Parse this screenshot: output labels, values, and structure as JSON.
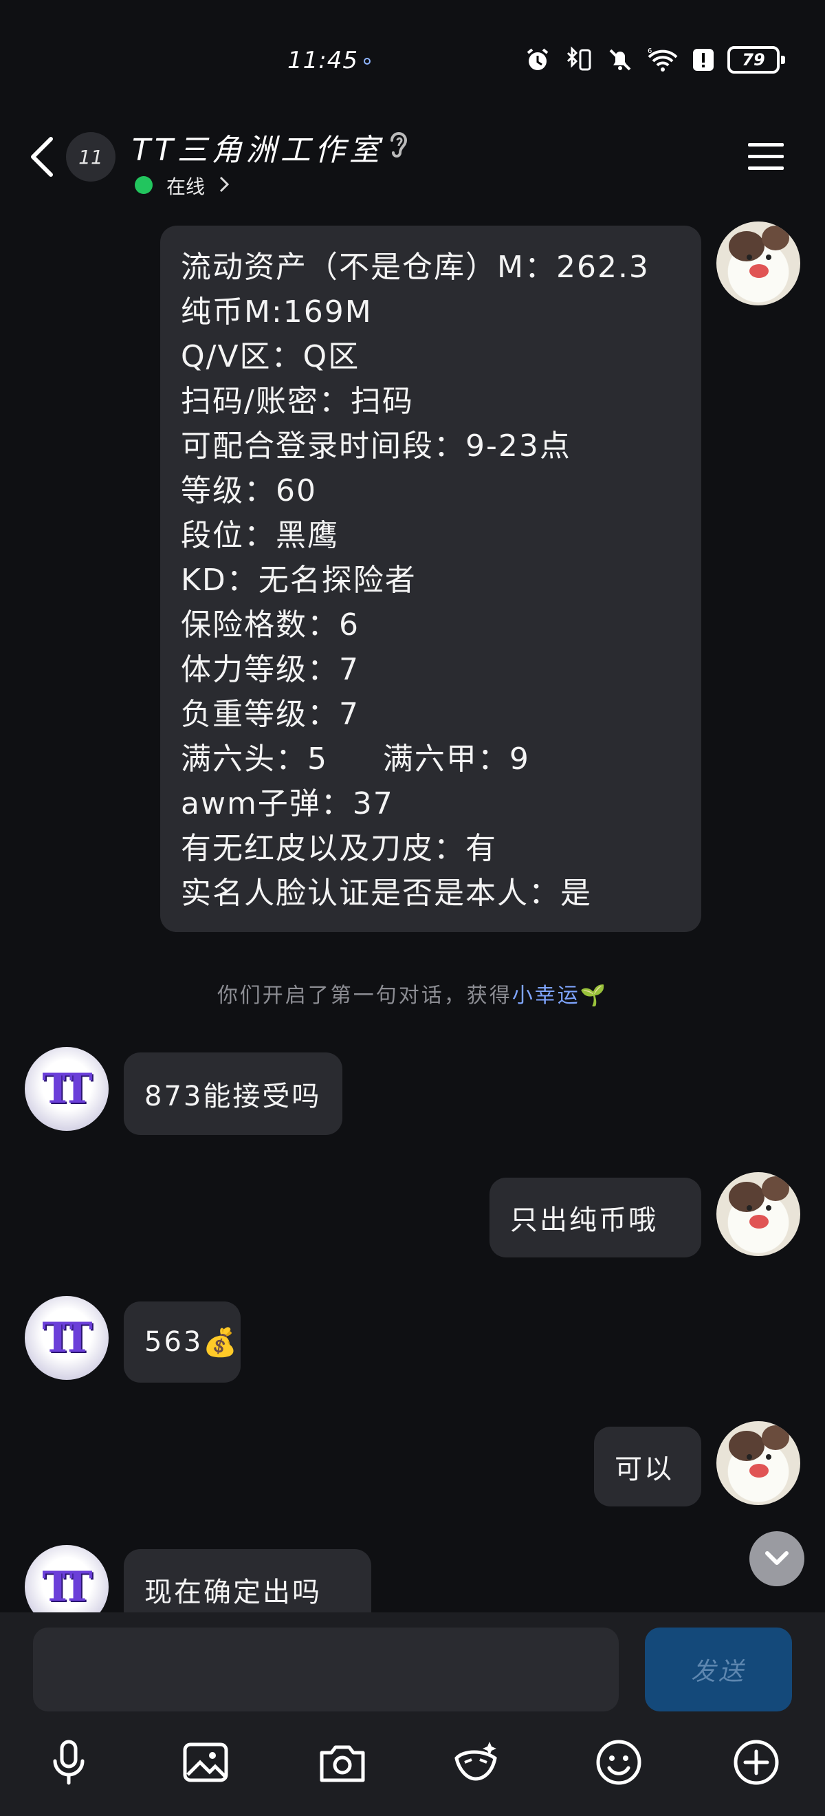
{
  "status_bar": {
    "time": "11:45",
    "battery": "79"
  },
  "header": {
    "unread_count": "11",
    "title": "TT三角洲工作室",
    "online_status": "在线"
  },
  "messages": {
    "profile_lines": [
      "流动资产（不是仓库）M：262.3",
      "纯币M:169M",
      "Q/V区：Q区",
      "扫码/账密：扫码",
      "可配合登录时间段：9-23点",
      "等级：60",
      "段位：黑鹰",
      "KD：无名探险者",
      "保险格数：6",
      "体力等级：7",
      "负重等级：7",
      "满六头：5     满六甲：9",
      "awm子弹：37",
      "有无红皮以及刀皮：有",
      "实名人脸认证是否是本人：是"
    ],
    "system_note_prefix": "你们开启了第一句对话，获得",
    "system_note_highlight": "小幸运",
    "system_note_emoji": "🌱",
    "m1": "873能接受吗",
    "m2": "只出纯币哦",
    "m3": "563",
    "m3_emoji": "💰",
    "m4": "可以",
    "m5": "现在确定出吗"
  },
  "composer": {
    "send_label": "发送"
  },
  "toolbar_icons": [
    "microphone-icon",
    "image-icon",
    "camera-icon",
    "sticker-icon",
    "emoji-icon",
    "plus-icon"
  ],
  "colors": {
    "background": "#0f1013",
    "bubble": "#2a2b30",
    "online": "#22c55e",
    "send_button": "#14497a",
    "highlight": "#7fa5ff"
  }
}
